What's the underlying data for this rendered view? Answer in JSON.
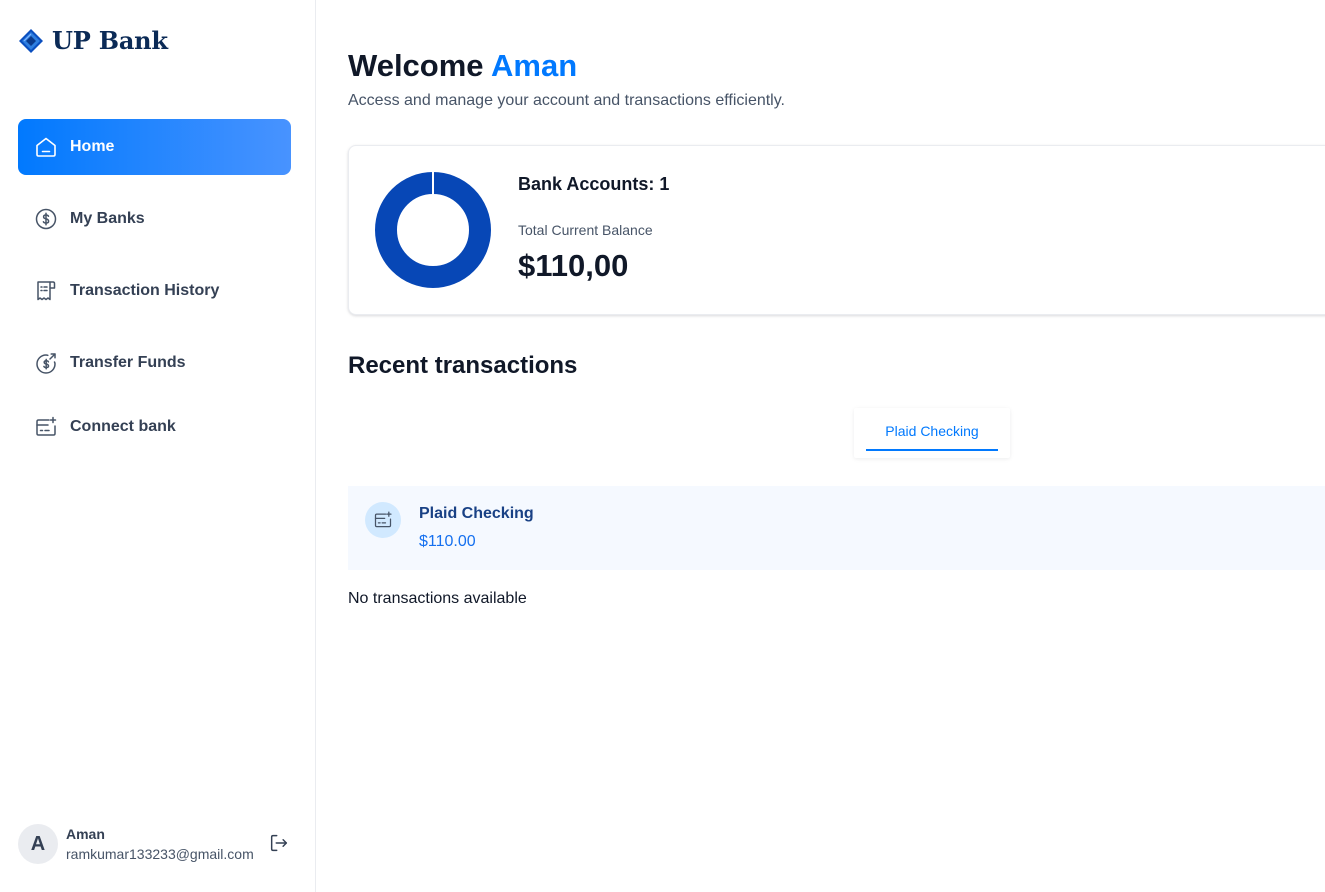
{
  "brand": {
    "name": "UP Bank",
    "logo_icon": "bank-logo-icon",
    "logo_color": "#0b4fbf"
  },
  "sidebar": {
    "items": [
      {
        "label": "Home",
        "icon": "home-icon",
        "active": true
      },
      {
        "label": "My Banks",
        "icon": "dollar-circle-icon",
        "active": false
      },
      {
        "label": "Transaction History",
        "icon": "receipt-icon",
        "active": false
      },
      {
        "label": "Transfer Funds",
        "icon": "money-send-icon",
        "active": false
      },
      {
        "label": "Connect bank",
        "icon": "connect-bank-icon",
        "active": false
      }
    ],
    "user": {
      "initial": "A",
      "name": "Aman",
      "email": "ramkumar133233@gmail.com",
      "logout_icon": "logout-icon"
    }
  },
  "header": {
    "greeting": "Welcome",
    "user_name": "Aman",
    "subtitle": "Access and manage your account and transactions efficiently."
  },
  "balance_card": {
    "accounts_label": "Bank Accounts: 1",
    "balance_label": "Total Current Balance",
    "balance_value": "$110,00",
    "donut_color": "#0747b6"
  },
  "recent": {
    "title": "Recent transactions",
    "tabs": [
      {
        "label": "Plaid Checking",
        "active": true
      }
    ],
    "account": {
      "name": "Plaid Checking",
      "amount": "$110.00",
      "icon": "bank-card-icon"
    },
    "empty_message": "No transactions available"
  },
  "colors": {
    "accent": "#0179fe",
    "text_primary": "#101828",
    "text_secondary": "#475467",
    "account_bg": "#f5f9ff"
  }
}
